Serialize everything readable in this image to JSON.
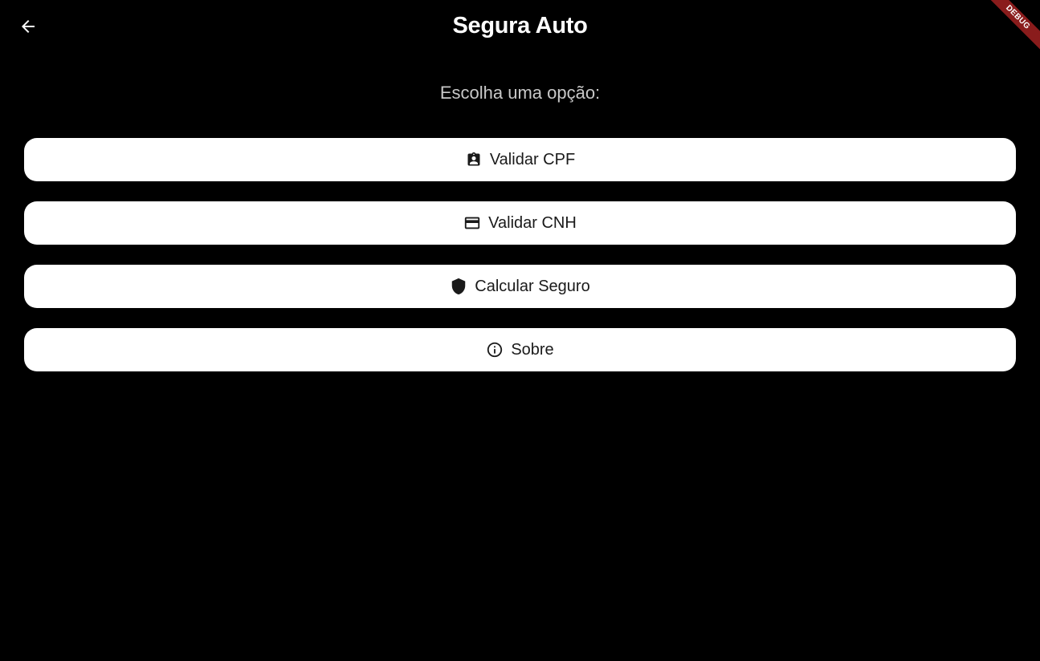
{
  "appbar": {
    "title": "Segura Auto",
    "back_icon": "arrow-back-icon",
    "debug_label": "DEBUG",
    "debug_color": "#8a1c1c"
  },
  "main": {
    "subtitle": "Escolha uma opção:",
    "buttons": [
      {
        "label": "Validar CPF",
        "icon": "assignment-ind-icon"
      },
      {
        "label": "Validar CNH",
        "icon": "credit-card-icon"
      },
      {
        "label": "Calcular Seguro",
        "icon": "shield-icon"
      },
      {
        "label": "Sobre",
        "icon": "info-icon"
      }
    ]
  },
  "colors": {
    "background": "#000000",
    "button_bg": "#ffffff",
    "button_text": "#1a1a1a",
    "subtitle": "#c8c8c8"
  }
}
